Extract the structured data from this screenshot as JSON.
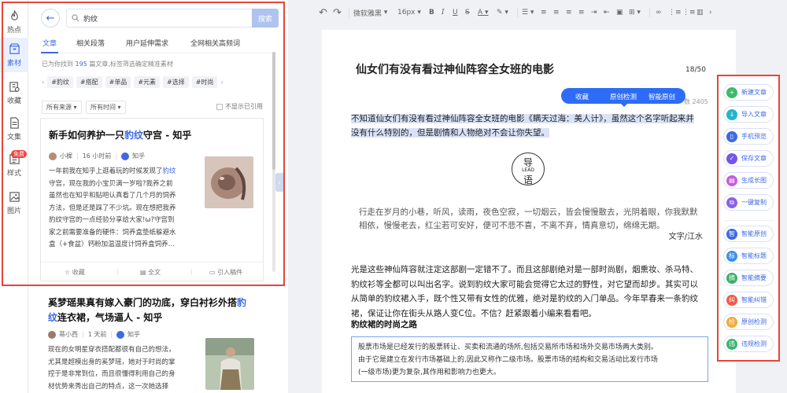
{
  "nav": [
    {
      "label": "热点",
      "icon": "flame-icon"
    },
    {
      "label": "素材",
      "icon": "material-icon",
      "active": true
    },
    {
      "label": "收藏",
      "icon": "bookmark-icon"
    },
    {
      "label": "文集",
      "icon": "document-icon"
    },
    {
      "label": "样式",
      "icon": "style-icon",
      "badge": "免费"
    },
    {
      "label": "图片",
      "icon": "image-icon"
    }
  ],
  "search": {
    "query": "豹纹",
    "button": "搜索"
  },
  "tabs": [
    "文章",
    "相关段落",
    "用户延伸需求",
    "全网相关高频词"
  ],
  "hint": {
    "pre": "已为你找到",
    "count": "195",
    "post": "篇文章,标签筛选确定精准素材"
  },
  "tags": [
    "#豹纹",
    "#搭配",
    "#单品",
    "#元素",
    "#选择",
    "#时尚"
  ],
  "filters": {
    "source": "所有来源",
    "time": "所有时间",
    "exclude": "不显示已引用"
  },
  "card1": {
    "title_pre": "新手如何养护一只",
    "title_hl": "豹纹",
    "title_post": "守宫 - 知乎",
    "author": "小樨",
    "time": "16 小时前",
    "source": "知乎",
    "body_l1_pre": "一年前我在知乎上逛着玩的时候发现了",
    "body_l1_hl": "豹纹",
    "body_l2": "守宫，现在我的小宝贝满一岁啦?我养之前",
    "body_l3": "虽然也在知乎和贴吧认真看了几个月的饲养",
    "body_l4": "方法，但是还是踩了不少坑。现在想把我养",
    "body_l5": "豹纹守宫的一点经验分享给大家!ω?守宫到",
    "body_l6": "家之前需要准备的硬件：饲养盒垫纸躲避水",
    "body_l7": "盒（+食盆）钙粉加温温度计饲养盒饲养...",
    "actions": [
      "收藏",
      "全文",
      "引入稿件"
    ]
  },
  "card2": {
    "title_l1_pre": "奚梦瑶果真有嫁入豪门的功底，穿白衬衫外搭",
    "title_l1_hl": "豹",
    "title_l2_hl": "纹",
    "title_l2_post": "连衣裙，气场逼人 - 知乎",
    "author": "蒂小西",
    "time": "1 天前",
    "source": "知乎",
    "body_l1": "现在的女明星穿衣搭配都很有自己的想法，",
    "body_l2": "尤其是超模出身的奚梦瑶，她对于时尚的掌",
    "body_l3": "控于是非常到位，而且很懂得利用自己的身",
    "body_l4": "材优势来秀出自己的特点，这一次她选择"
  },
  "toolbar": {
    "font": "微软雅黑",
    "size": "16px"
  },
  "doc": {
    "title": "仙女们有没有看过神仙阵容全女班的电影",
    "counter": "18/50",
    "popover": [
      "收藏",
      "原创检测",
      "智能原创"
    ],
    "wordcount": "数 2405",
    "sel_l1": "不知道仙女们有没有看过神仙阵容全女班的电影《瞒天过海：美人计》，虽然这个名字听起来并",
    "sel_l2": "没有什么特别的，但是剧情和人物绝对不会让你失望。",
    "logo_top": "导",
    "logo_mid": "LEAD",
    "logo_bot": "语",
    "poem_l1": "行走在岁月的小巷，听风，读雨，夜色空寂，一切烟云，皆会慢慢散去，光阴着眼，你我默默",
    "poem_l2": "相依，慢慢老去，红尘若可安好，便可不悲不喜，不离不弃，情真意切，绵绵无期。",
    "poem_source": "文字/江水",
    "main_l1": "光是这些神仙阵容就注定这部剧一定错不了。而且这部剧绝对是一部时尚剧，烟熏妆、杀马特、",
    "main_l2": "豹纹衫等全都可以叫出名字。说到豹纹大家可能会觉得它太过的野性，对它望而却步。其实可以",
    "main_l3": "从简单的豹纹裙入手，既个性又带有女性的优雅，绝对是豹纹的入门单品。今年早春来一条豹纹",
    "main_l4": "裙，保证让你在街头从路人变C位。不信？赶紧跟着小编来看看吧。",
    "subheading": "豹纹裙的时尚之路",
    "quote_l1": "股票市场是已经发行的股票转让、买卖和流通的场所,包括交易所市场和场外交易市场两大类别。",
    "quote_l2": "由于它是建立在发行市场基础上的,因此又称作二级市场。股票市场的结构和交易活动比发行市场",
    "quote_l3": "(一级市场)更为复杂,其作用和影响力也更大。"
  },
  "right_tools": [
    {
      "label": "新建文章",
      "color": "#3dbb6a",
      "glyph": "+"
    },
    {
      "label": "导入文章",
      "color": "#24b6c8",
      "glyph": "↓"
    },
    {
      "label": "手机预览",
      "color": "#3e6ae1",
      "glyph": "▯"
    },
    {
      "label": "保存文章",
      "color": "#7456e8",
      "glyph": "✓"
    },
    {
      "label": "生成长图",
      "color": "#c75ce0",
      "glyph": "▤"
    },
    {
      "label": "一键复制",
      "color": "#8a63e6",
      "glyph": "⧉"
    },
    {
      "label": "智能原创",
      "color": "#3e6ae1",
      "glyph": "智"
    },
    {
      "label": "智能标题",
      "color": "#3e8ee8",
      "glyph": "标"
    },
    {
      "label": "智能摘要",
      "color": "#3dae6a",
      "glyph": "摘"
    },
    {
      "label": "智能纠错",
      "color": "#f05a4a",
      "glyph": "纠"
    },
    {
      "label": "原创检测",
      "color": "#f2a93b",
      "glyph": "检"
    },
    {
      "label": "违规检测",
      "color": "#3cb56f",
      "glyph": "违"
    }
  ]
}
